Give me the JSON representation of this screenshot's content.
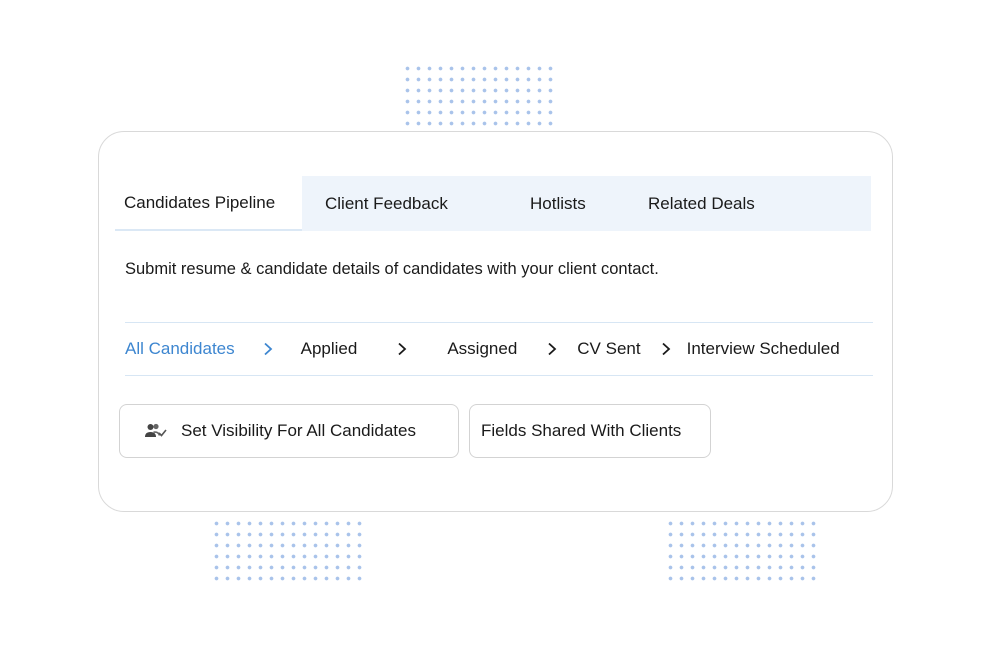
{
  "tabs": [
    {
      "label": "Candidates Pipeline",
      "active": true
    },
    {
      "label": "Client Feedback",
      "active": false
    },
    {
      "label": "Hotlists",
      "active": false
    },
    {
      "label": "Related Deals",
      "active": false
    }
  ],
  "description": "Submit resume & candidate details of candidates with your client contact.",
  "pipeline": {
    "stages": [
      {
        "label": "All Candidates",
        "active": true
      },
      {
        "label": "Applied",
        "active": false
      },
      {
        "label": "Assigned",
        "active": false
      },
      {
        "label": "CV Sent",
        "active": false
      },
      {
        "label": "Interview Scheduled",
        "active": false
      }
    ],
    "separator_icon": "chevron-right-icon"
  },
  "buttons": {
    "set_visibility": {
      "label": "Set Visibility For All Candidates",
      "icon": "users-check-icon"
    },
    "fields_shared": {
      "label": "Fields Shared With Clients"
    }
  },
  "colors": {
    "accent": "#3d86d0",
    "tab_strip_bg": "#eef4fb",
    "divider": "#d7e6f4",
    "dots": "#a9c3ea"
  }
}
